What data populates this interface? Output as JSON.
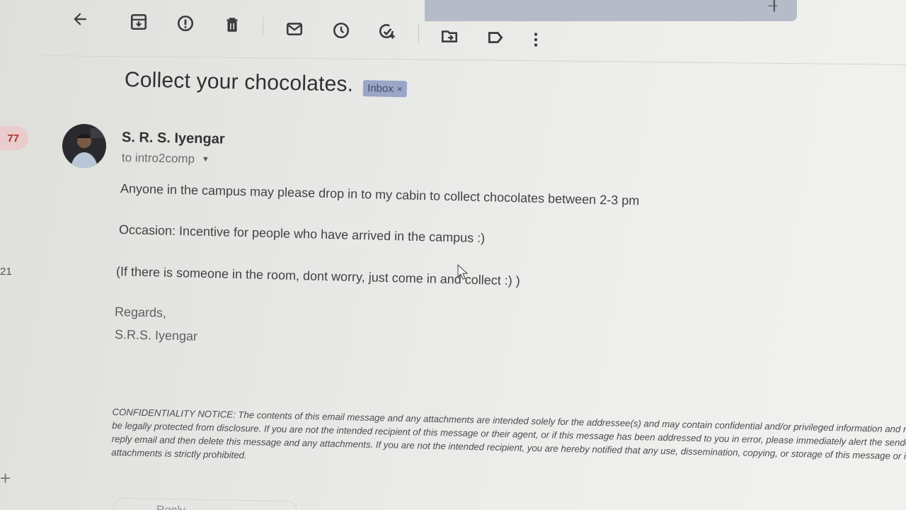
{
  "toolbar": {
    "buttons": [
      {
        "name": "back-arrow-icon",
        "label": "Back"
      },
      {
        "name": "archive-icon",
        "label": "Archive"
      },
      {
        "name": "report-spam-icon",
        "label": "Report spam"
      },
      {
        "name": "delete-icon",
        "label": "Delete"
      },
      {
        "name": "mark-unread-icon",
        "label": "Mark as unread"
      },
      {
        "name": "snooze-icon",
        "label": "Snooze"
      },
      {
        "name": "add-to-tasks-icon",
        "label": "Add to Tasks"
      },
      {
        "name": "move-to-icon",
        "label": "Move to"
      },
      {
        "name": "label-icon",
        "label": "Labels"
      },
      {
        "name": "more-vert-icon",
        "label": "More"
      }
    ]
  },
  "sidebar": {
    "count_badge": "77",
    "count_2": "21"
  },
  "email": {
    "subject": "Collect your chocolates.",
    "label_badge": "Inbox",
    "label_remove": "×",
    "sender_name": "S. R. S. Iyengar",
    "recipient": "to intro2comp",
    "body_lines": [
      "Anyone in the campus may please drop in to my cabin to collect chocolates between 2-3 pm",
      "Occasion: Incentive for people who have arrived in the campus :)",
      "(If there is someone in the room, dont worry, just come in and collect :) )",
      "Regards,",
      "S.R.S. Iyengar"
    ],
    "notice": {
      "heading": "CONFIDENTIALITY NOTICE:",
      "text": "The contents of this email message and any attachments are intended solely for the addressee(s) and may contain confidential and/or privileged information and may be legally protected from disclosure. If you are not the intended recipient of this message or their agent, or if this message has been addressed to you in error, please immediately alert the sender by reply email and then delete this message and any attachments. If you are not the intended recipient, you are hereby notified that any use, dissemination, copying, or storage of this message or its attachments is strictly prohibited."
    },
    "reply_label": "Reply"
  },
  "colors": {
    "badge_bg": "#99a6c6",
    "count_badge_bg": "#e9cccb",
    "count_badge_text": "#b2302d"
  }
}
